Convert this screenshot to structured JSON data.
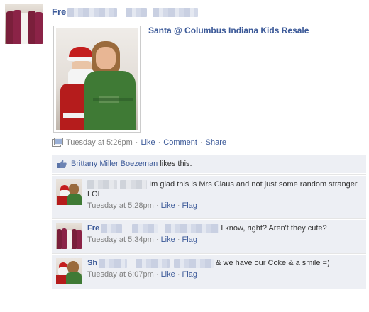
{
  "post": {
    "poster_name_visible": "Fre",
    "album_link": "Santa @ Columbus Indiana Kids Resale",
    "meta": {
      "time": "Tuesday at 5:26pm",
      "like": "Like",
      "comment": "Comment",
      "share": "Share",
      "separator": "·"
    }
  },
  "likes": {
    "name": "Brittany Miller Boezeman",
    "suffix": "likes this."
  },
  "comments": [
    {
      "name_visible": "",
      "text": "Im glad this is Mrs Claus and not just some random stranger LOL",
      "time": "Tuesday at 5:28pm",
      "like": "Like",
      "flag": "Flag"
    },
    {
      "name_visible": "Fre",
      "text": "I know, right? Aren't they cute?",
      "time": "Tuesday at 5:34pm",
      "like": "Like",
      "flag": "Flag"
    },
    {
      "name_visible": "Sh",
      "text": "& we have our Coke & a smile =)",
      "time": "Tuesday at 6:07pm",
      "like": "Like",
      "flag": "Flag"
    }
  ],
  "colors": {
    "link": "#3b5998",
    "meta_gray": "#808080",
    "feedback_bg": "#edeff4",
    "text": "#333333"
  },
  "icons": [
    "album-icon",
    "thumbs-up-icon"
  ]
}
